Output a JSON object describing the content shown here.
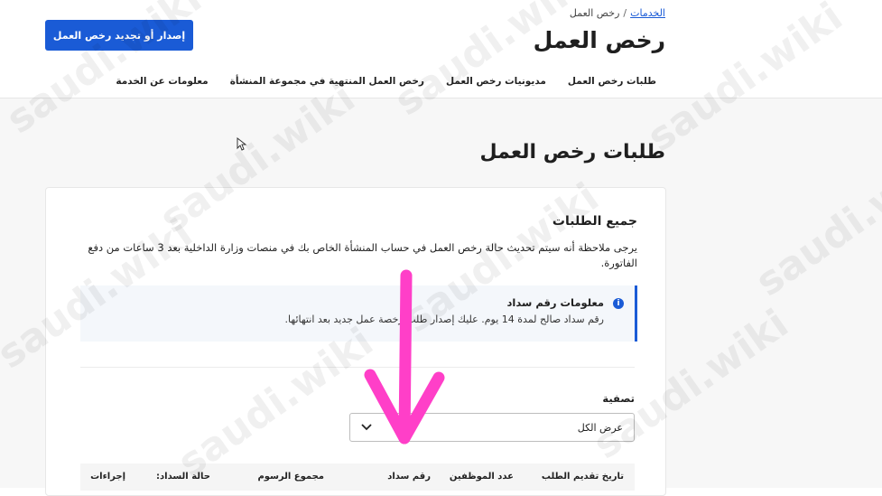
{
  "breadcrumb": {
    "home": "الخدمات",
    "current": "رخص العمل",
    "separator": "/"
  },
  "page_title": "رخص العمل",
  "primary_action": "إصدار أو تجديد رخص العمل",
  "tabs": [
    {
      "label": "طلبات رخص العمل"
    },
    {
      "label": "مديونيات رخص العمل"
    },
    {
      "label": "رخص العمل المنتهية في مجموعة المنشأة"
    },
    {
      "label": "معلومات عن الخدمة"
    }
  ],
  "section_title": "طلبات رخص العمل",
  "card": {
    "title": "جميع الطلبات",
    "description": "يرجى ملاحظة أنه سيتم تحديث حالة رخص العمل في حساب المنشأة الخاص بك في منصات وزارة الداخلية بعد 3 ساعات من دفع الفاتورة.",
    "info": {
      "title": "معلومات رقم سداد",
      "text": "رقم سداد صالح لمدة 14 يوم. عليك إصدار طلب رخصة عمل جديد بعد انتهائها."
    },
    "filter": {
      "label": "تصفية",
      "value": "عرض الكل"
    },
    "table_headers": [
      "تاريخ تقديم الطلب",
      "عدد الموظفين",
      "رقم سداد",
      "مجموع الرسوم",
      "حالة السداد:",
      "إجراءات"
    ]
  },
  "watermark_text": "saudi.wiki",
  "colors": {
    "primary": "#1a5bd6",
    "annotation_arrow": "#ff3fc8"
  }
}
